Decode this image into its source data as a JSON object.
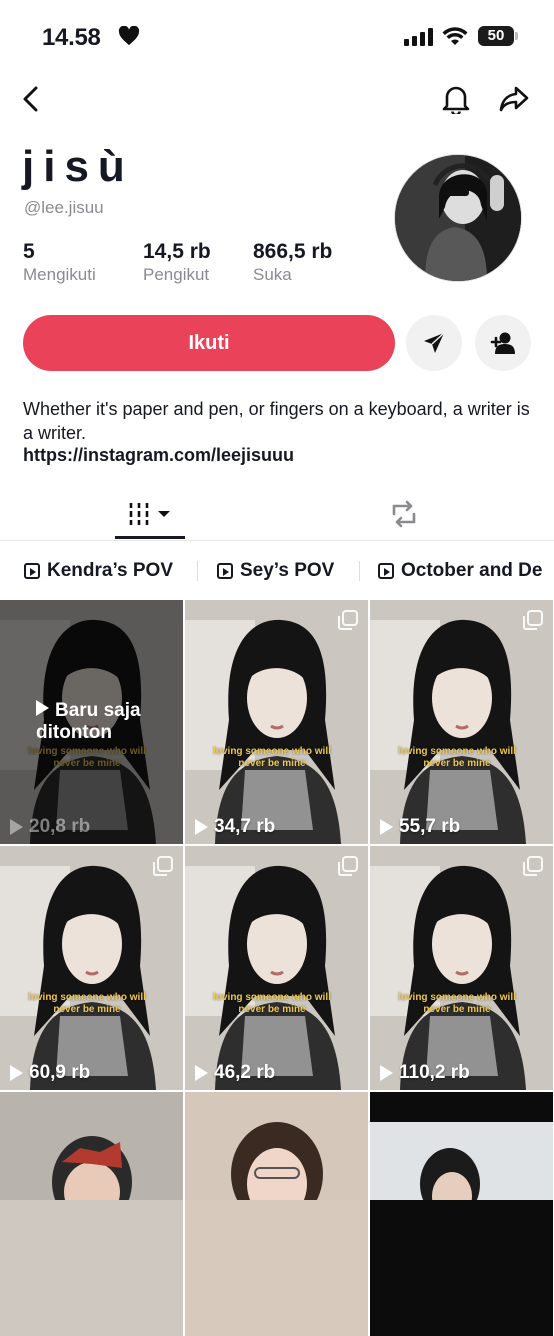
{
  "status_bar": {
    "time": "14.58",
    "battery": "50"
  },
  "profile": {
    "display_name": "jisù",
    "username": "@lee.jisuu",
    "stats": [
      {
        "value": "5",
        "label": "Mengikuti"
      },
      {
        "value": "14,5 rb",
        "label": "Pengikut"
      },
      {
        "value": "866,5 rb",
        "label": "Suka"
      }
    ],
    "follow_label": "Ikuti",
    "bio": "Whether it's paper and pen, or fingers on a keyboard, a writer is a writer.",
    "link": "https://instagram.com/leejisuuu"
  },
  "playlists": [
    "Kendra’s POV",
    "Sey’s POV",
    "October and De"
  ],
  "grid": [
    {
      "views": "20,8 rb",
      "caption": "loving someone who will never be mine",
      "watched": true,
      "watched_label": "Baru saja ditonton"
    },
    {
      "views": "34,7 rb",
      "caption": "loving someone who will never be mine"
    },
    {
      "views": "55,7 rb",
      "caption": "loving someone who will never be mine"
    },
    {
      "views": "60,9 rb",
      "caption": "loving someone who will never be mine"
    },
    {
      "views": "46,2 rb",
      "caption": "loving someone who will never be mine"
    },
    {
      "views": "110,2 rb",
      "caption": "loving someone who will never be mine"
    }
  ],
  "colors": {
    "follow": "#ea4359",
    "text": "#161823",
    "muted": "#8a8b91"
  }
}
